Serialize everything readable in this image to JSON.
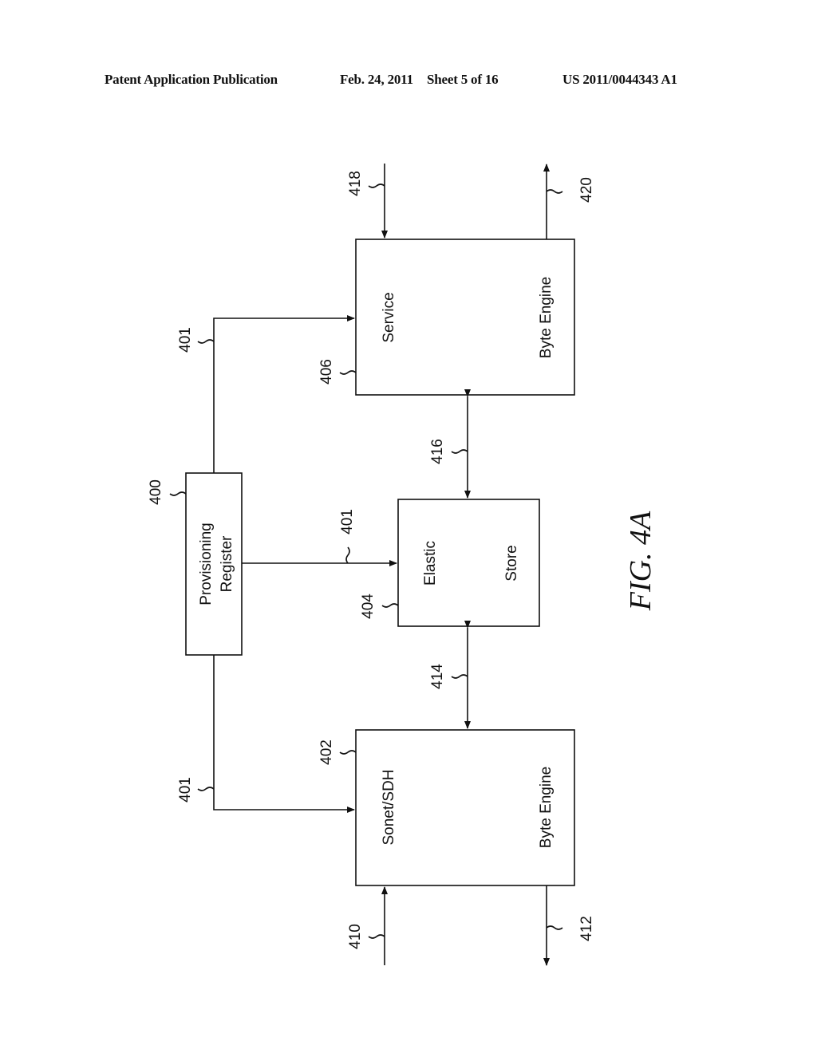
{
  "header": {
    "publication": "Patent Application Publication",
    "date": "Feb. 24, 2011",
    "sheet": "Sheet 5 of 16",
    "number": "US 2011/0044343 A1"
  },
  "figure": {
    "caption": "FIG. 4A",
    "blocks": {
      "provisioning": {
        "ref": "400",
        "line1": "Provisioning",
        "line2": "Register"
      },
      "sonet": {
        "ref": "402",
        "line1": "Sonet/SDH",
        "line2": "Byte Engine"
      },
      "elastic": {
        "ref": "404",
        "line1": "Elastic",
        "line2": "Store"
      },
      "service": {
        "ref": "406",
        "line1": "Service",
        "line2": "Byte Engine"
      }
    },
    "signals": {
      "prov_to_service": "401",
      "prov_to_elastic": "401",
      "prov_to_sonet": "401",
      "sonet_in": "410",
      "sonet_out": "412",
      "sonet_elastic": "414",
      "elastic_service": "416",
      "service_in": "418",
      "service_out": "420"
    }
  }
}
